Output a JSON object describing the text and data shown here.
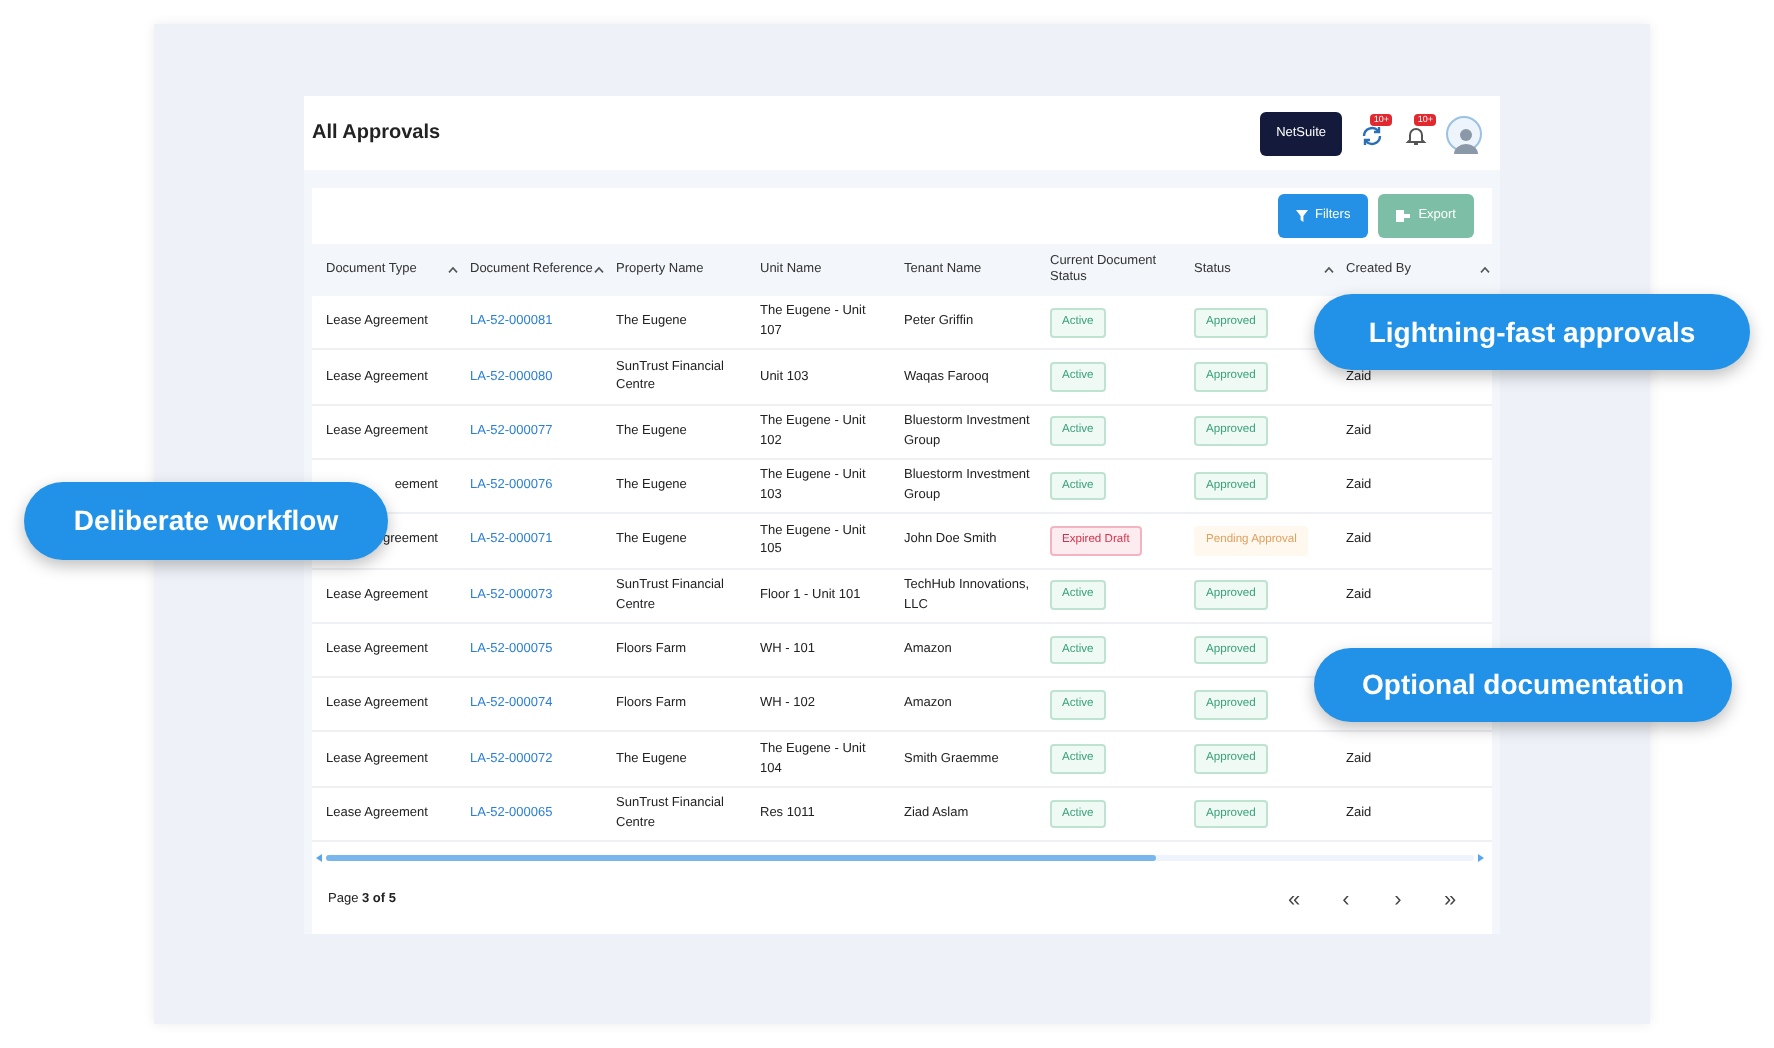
{
  "header": {
    "title": "All Approvals",
    "integration_button": "NetSuite",
    "notifications": [
      {
        "badge": "10+"
      },
      {
        "badge": "10+"
      }
    ]
  },
  "toolbar": {
    "buttons": [
      {
        "label": "Filters",
        "kind": "primary"
      },
      {
        "label": "Export",
        "kind": "secondary"
      }
    ]
  },
  "table": {
    "columns": [
      {
        "label": "Document Type",
        "sortable": true
      },
      {
        "label": "Document Reference",
        "sortable": true
      },
      {
        "label": "Property Name",
        "sortable": false
      },
      {
        "label": "Unit Name",
        "sortable": false
      },
      {
        "label": "Tenant Name",
        "sortable": false
      },
      {
        "label": "Current Document Status",
        "sortable": false
      },
      {
        "label": "Status",
        "sortable": true
      },
      {
        "label": "Created By",
        "sortable": true
      }
    ],
    "rows": [
      {
        "document_type": "Lease Agreement",
        "covered": false,
        "reference": "LA-52-000081",
        "property": "The Eugene",
        "unit": "The Eugene - Unit 107",
        "tenant": "Peter Griffin",
        "current_status": {
          "label": "Active",
          "kind": "success"
        },
        "status": {
          "label": "Approved",
          "kind": "success"
        }
      },
      {
        "document_type": "Lease Agreement",
        "covered": false,
        "reference": "LA-52-000080",
        "property": "SunTrust Financial Centre",
        "unit": "Unit 103",
        "tenant": "Waqas Farooq",
        "current_status": {
          "label": "Active",
          "kind": "success"
        },
        "status": {
          "label": "Approved",
          "kind": "success"
        },
        "created_by": "Zaid"
      },
      {
        "document_type": "Lease Agreement",
        "covered": false,
        "reference": "LA-52-000077",
        "property": "The Eugene",
        "unit": "The Eugene - Unit 102",
        "tenant": "Bluestorm Investment Group",
        "current_status": {
          "label": "Active",
          "kind": "success"
        },
        "status": {
          "label": "Approved",
          "kind": "success"
        },
        "created_by": "Zaid"
      },
      {
        "document_type": "eement",
        "covered": true,
        "reference": "LA-52-000076",
        "property": "The Eugene",
        "unit": "The Eugene - Unit 103",
        "tenant": "Bluestorm Investment Group",
        "current_status": {
          "label": "Active",
          "kind": "success"
        },
        "status": {
          "label": "Approved",
          "kind": "success"
        },
        "created_by": "Zaid"
      },
      {
        "document_type": "greement",
        "covered": true,
        "reference": "LA-52-000071",
        "property": "The Eugene",
        "unit": "The Eugene - Unit 105",
        "tenant": "John Doe Smith",
        "current_status": {
          "label": "Expired Draft",
          "kind": "danger"
        },
        "status": {
          "label": "Pending Approval",
          "kind": "warning"
        },
        "created_by": "Zaid"
      },
      {
        "document_type": "Lease Agreement",
        "covered": false,
        "reference": "LA-52-000073",
        "property": "SunTrust Financial Centre",
        "unit": "Floor 1 - Unit 101",
        "tenant": "TechHub Innovations, LLC",
        "current_status": {
          "label": "Active",
          "kind": "success"
        },
        "status": {
          "label": "Approved",
          "kind": "success"
        },
        "created_by": "Zaid"
      },
      {
        "document_type": "Lease Agreement",
        "covered": false,
        "reference": "LA-52-000075",
        "property": "Floors Farm",
        "unit": "WH - 101",
        "tenant": "Amazon",
        "current_status": {
          "label": "Active",
          "kind": "success"
        },
        "status": {
          "label": "Approved",
          "kind": "success"
        }
      },
      {
        "document_type": "Lease Agreement",
        "covered": false,
        "reference": "LA-52-000074",
        "property": "Floors Farm",
        "unit": "WH - 102",
        "tenant": "Amazon",
        "current_status": {
          "label": "Active",
          "kind": "success"
        },
        "status": {
          "label": "Approved",
          "kind": "success"
        }
      },
      {
        "document_type": "Lease Agreement",
        "covered": false,
        "reference": "LA-52-000072",
        "property": "The Eugene",
        "unit": "The Eugene - Unit 104",
        "tenant": "Smith Graemme",
        "current_status": {
          "label": "Active",
          "kind": "success"
        },
        "status": {
          "label": "Approved",
          "kind": "success"
        },
        "created_by": "Zaid"
      },
      {
        "document_type": "Lease Agreement",
        "covered": false,
        "reference": "LA-52-000065",
        "property": "SunTrust Financial Centre",
        "unit": "Res 1011",
        "tenant": "Ziad Aslam",
        "current_status": {
          "label": "Active",
          "kind": "success"
        },
        "status": {
          "label": "Approved",
          "kind": "success"
        },
        "created_by": "Zaid"
      }
    ]
  },
  "pagination": {
    "label": "Page **3 of 5**",
    "buttons": [
      "«",
      "‹",
      "›",
      "»"
    ]
  },
  "callouts": [
    {
      "text": "Lightning-fast approvals"
    },
    {
      "text": "Deliberate workflow"
    },
    {
      "text": "Optional documentation"
    }
  ]
}
